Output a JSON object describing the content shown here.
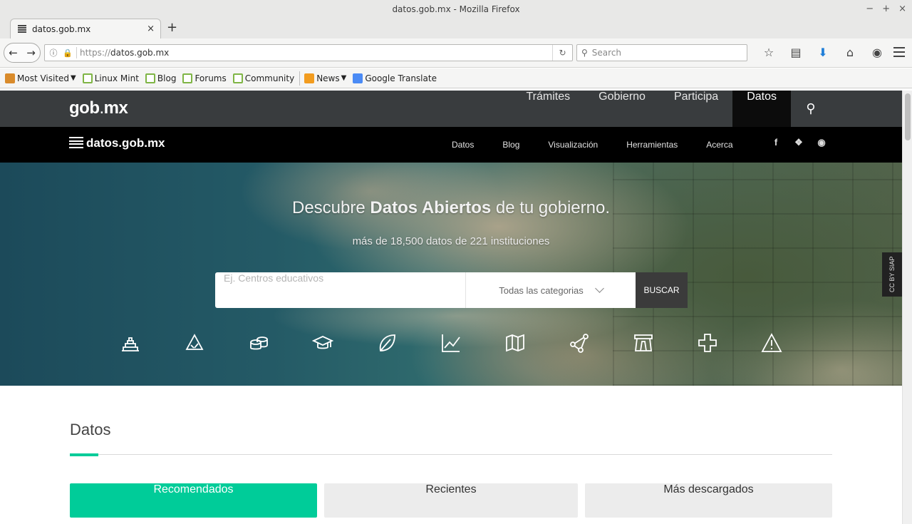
{
  "window": {
    "title": "datos.gob.mx - Mozilla Firefox",
    "controls": [
      "−",
      "+",
      "×"
    ]
  },
  "tab": {
    "title": "datos.gob.mx",
    "close": "×",
    "new": "+"
  },
  "urlbar": {
    "protocol": "https://",
    "host": "datos.gob.mx"
  },
  "search": {
    "placeholder": "Search"
  },
  "bookmarks": [
    {
      "label": "Most Visited",
      "icon": "folder-icon",
      "dropdown": true
    },
    {
      "label": "Linux Mint",
      "icon": "mint-icon"
    },
    {
      "label": "Blog",
      "icon": "mint-icon"
    },
    {
      "label": "Forums",
      "icon": "mint-icon"
    },
    {
      "label": "Community",
      "icon": "mint-icon"
    },
    {
      "label": "News",
      "icon": "rss-icon",
      "dropdown": true
    },
    {
      "label": "Google Translate",
      "icon": "google-translate-icon"
    }
  ],
  "gob": {
    "logo_a": "gob",
    "logo_dot": ".",
    "logo_b": "mx",
    "menu": [
      "Trámites",
      "Gobierno",
      "Participa",
      "Datos"
    ],
    "active": "Datos"
  },
  "datos": {
    "logo": "datos.gob.mx",
    "links": [
      "Datos",
      "Blog",
      "Visualización",
      "Herramientas",
      "Acerca"
    ],
    "socials": [
      "facebook-icon",
      "twitter-icon",
      "github-icon"
    ]
  },
  "hero": {
    "title_pre": "Descubre ",
    "title_bold": "Datos Abiertos",
    "title_post": " de tu gobierno.",
    "subtitle": "más de 18,500 datos de 221 instituciones",
    "search_placeholder": "Ej. Centros educativos",
    "category_select": "Todas las categorias",
    "search_button": "BUSCAR",
    "badge": "CC BY SIAP",
    "categories": [
      "infraestructura-icon",
      "medio-ambiente-icon",
      "economia-icon",
      "educacion-icon",
      "sustentabilidad-icon",
      "finanzas-icon",
      "geografia-icon",
      "red-icon",
      "desarrollo-icon",
      "salud-icon",
      "seguridad-icon"
    ]
  },
  "section": {
    "title": "Datos",
    "tabs": [
      "Recomendados",
      "Recientes",
      "Más descargados"
    ],
    "active_tab": "Recomendados"
  },
  "colors": {
    "accent": "#00cc99",
    "gob_nav": "#393c3e",
    "datos_nav": "#000000"
  }
}
